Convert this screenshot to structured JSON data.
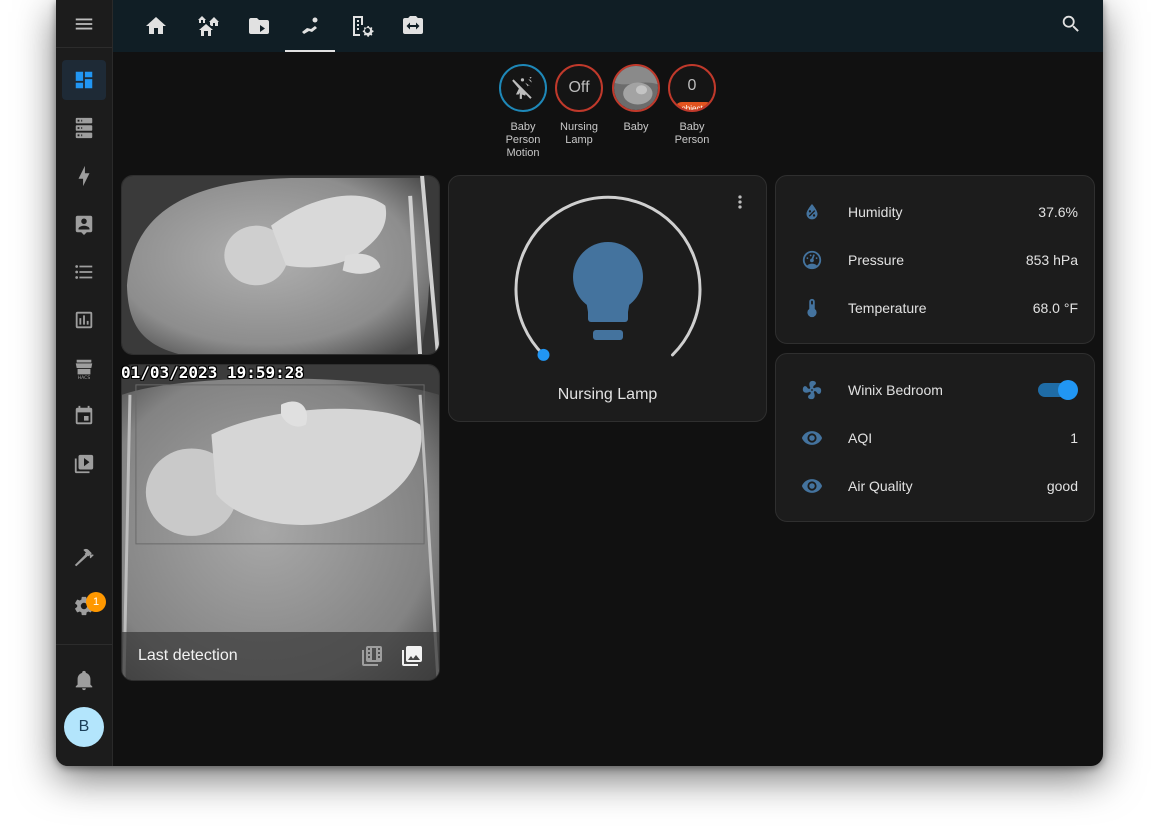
{
  "sidebar": {
    "items": [
      {
        "name": "overview",
        "icon": "view-dashboard-icon"
      },
      {
        "name": "energy-storage",
        "icon": "server-icon"
      },
      {
        "name": "energy",
        "icon": "lightning-bolt-icon"
      },
      {
        "name": "person",
        "icon": "account-box-icon"
      },
      {
        "name": "todo",
        "icon": "format-list-bulleted-icon"
      },
      {
        "name": "history",
        "icon": "chart-box-icon"
      },
      {
        "name": "hacs",
        "icon": "hacs-icon"
      },
      {
        "name": "calendar",
        "icon": "calendar-icon"
      },
      {
        "name": "media",
        "icon": "play-box-icon"
      },
      {
        "name": "developer-tools",
        "icon": "hammer-icon"
      },
      {
        "name": "settings",
        "icon": "cog-icon"
      },
      {
        "name": "notifications",
        "icon": "bell-icon"
      }
    ],
    "settings_badge": "1",
    "avatar_initial": "B"
  },
  "topbar": {
    "tabs": [
      {
        "icon": "home-icon"
      },
      {
        "icon": "home-group-icon"
      },
      {
        "icon": "folder-play-icon"
      },
      {
        "icon": "baby-crawl-icon",
        "active": true
      },
      {
        "icon": "office-building-cog-icon"
      },
      {
        "icon": "camera-switch-icon"
      }
    ],
    "search_icon": "magnify-icon",
    "menu_icon": "dots-vertical-icon"
  },
  "badges": [
    {
      "label": "Baby Person Motion",
      "icon": "motion-sensor-off-icon"
    },
    {
      "label": "Nursing Lamp",
      "state": "Off"
    },
    {
      "label": "Baby",
      "image": "camera-thumbnail"
    },
    {
      "label": "Baby Person",
      "state": "0",
      "unit": "objects"
    }
  ],
  "camera": {
    "timestamp": "01/03/2023 19:59:28",
    "footer_title": "Last detection",
    "clips_icon": "filmstrip-box-multiple-icon",
    "snapshots_icon": "image-multiple-icon"
  },
  "light": {
    "name": "Nursing Lamp",
    "brightness": 0,
    "icon": "lightbulb-icon",
    "color": "#44739e"
  },
  "sensors": [
    {
      "name": "Humidity",
      "value": "37.6%",
      "icon": "water-percent-icon"
    },
    {
      "name": "Pressure",
      "value": "853 hPa",
      "icon": "gauge-icon"
    },
    {
      "name": "Temperature",
      "value": "68.0 °F",
      "icon": "thermometer-icon"
    }
  ],
  "air": [
    {
      "name": "Winix Bedroom",
      "toggle": true,
      "icon": "fan-icon"
    },
    {
      "name": "AQI",
      "value": "1",
      "icon": "eye-icon"
    },
    {
      "name": "Air Quality",
      "value": "good",
      "icon": "eye-icon"
    }
  ],
  "colors": {
    "accent": "#2196f3",
    "icon_blue": "#44739e",
    "badge_orange": "#ff9800",
    "object_red": "#e2541f"
  }
}
